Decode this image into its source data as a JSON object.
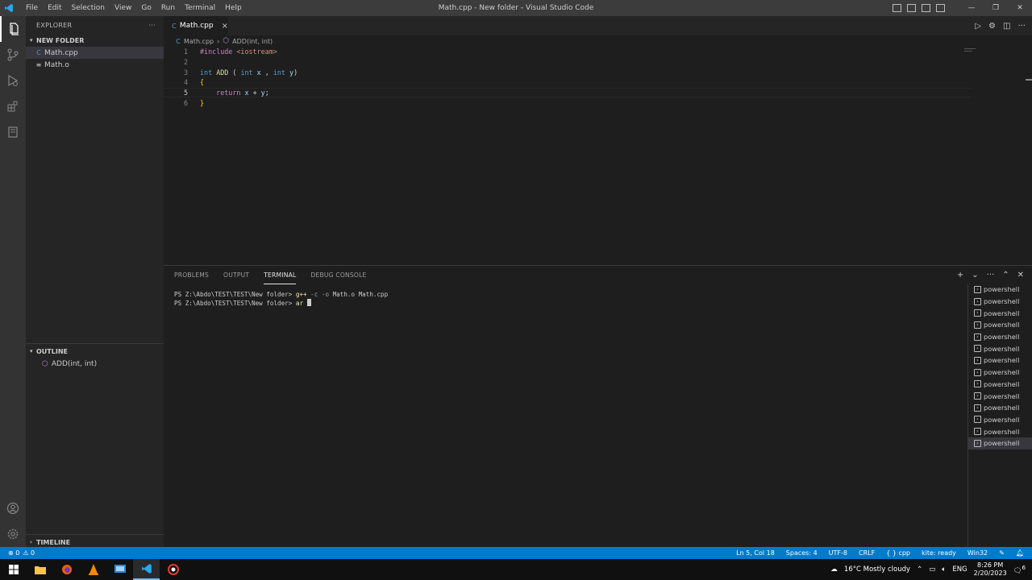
{
  "titlebar": {
    "menu": [
      "File",
      "Edit",
      "Selection",
      "View",
      "Go",
      "Run",
      "Terminal",
      "Help"
    ],
    "title": "Math.cpp - New folder - Visual Studio Code"
  },
  "sidebar": {
    "header": "EXPLORER",
    "more": "···",
    "folder": "NEW FOLDER",
    "files": [
      {
        "name": "Math.cpp",
        "icon": "C"
      },
      {
        "name": "Math.o",
        "icon": "≡"
      }
    ],
    "outline_title": "OUTLINE",
    "outline_item": "ADD(int, int)",
    "timeline_title": "TIMELINE"
  },
  "editor": {
    "tab_label": "Math.cpp",
    "tab_close": "×",
    "breadcrumb_file": "Math.cpp",
    "breadcrumb_sep": "›",
    "breadcrumb_symbol": "ADD(int, int)",
    "line_numbers": [
      "1",
      "2",
      "3",
      "4",
      "5",
      "6"
    ],
    "code": {
      "include_kw": "#include",
      "include_target": "<iostream>",
      "ret_type": "int",
      "fn_name": "ADD",
      "paren_open": "(",
      "p1_type": "int",
      "p1_name": "x",
      "comma": ",",
      "p2_type": "int",
      "p2_name": "y",
      "paren_close": ")",
      "brace_open": "{",
      "return_kw": "return",
      "ret_x": "x",
      "plus": "+",
      "ret_y": "y",
      "semicolon": ";",
      "brace_close": "}"
    }
  },
  "panel": {
    "tabs": [
      "PROBLEMS",
      "OUTPUT",
      "TERMINAL",
      "DEBUG CONSOLE"
    ],
    "active_tab": "TERMINAL",
    "terminal_lines": [
      {
        "prompt": "PS Z:\\Abdo\\TEST\\TEST\\New folder> ",
        "cmd": "g++",
        "args": " -c -o ",
        "rest": "Math.o Math.cpp"
      },
      {
        "prompt": "PS Z:\\Abdo\\TEST\\TEST\\New folder> ",
        "cmd": "ar",
        "args": " ",
        "rest": ""
      }
    ],
    "terminals": [
      "powershell",
      "powershell",
      "powershell",
      "powershell",
      "powershell",
      "powershell",
      "powershell",
      "powershell",
      "powershell",
      "powershell",
      "powershell",
      "powershell",
      "powershell",
      "powershell"
    ]
  },
  "statusbar": {
    "errors": "⊗ 0",
    "warnings": "⚠ 0",
    "position": "Ln 5, Col 18",
    "spaces": "Spaces: 4",
    "encoding": "UTF-8",
    "eol": "CRLF",
    "language": "cpp",
    "kite": "kite: ready",
    "platform": "Win32"
  },
  "taskbar": {
    "weather": "16°C  Mostly cloudy",
    "lang": "ENG",
    "time": "8:26 PM",
    "date": "2/20/2023",
    "notif_count": "6"
  }
}
